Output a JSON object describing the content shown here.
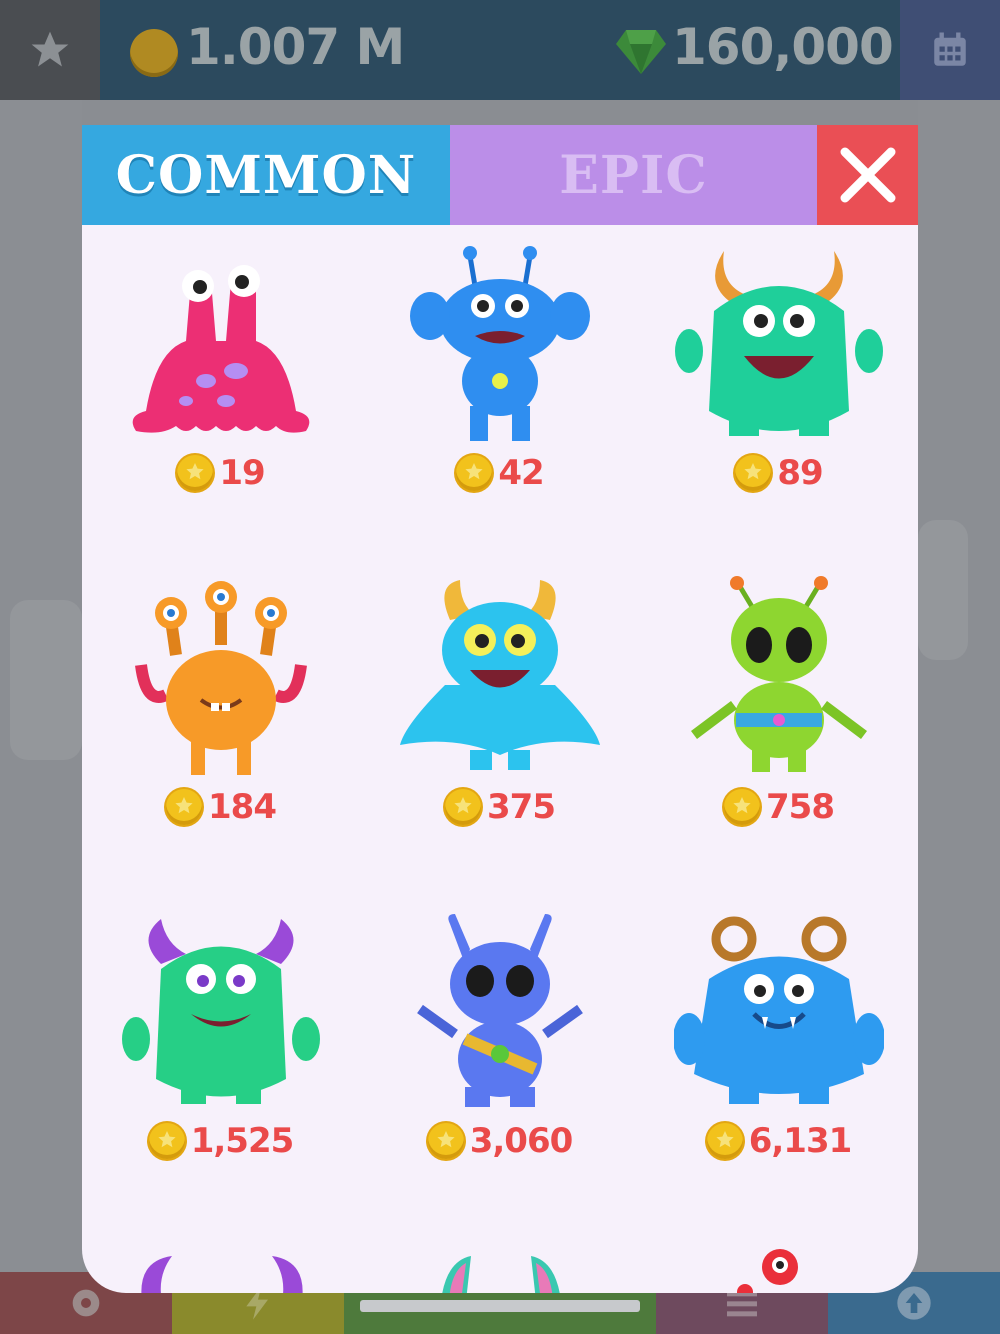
{
  "top_bar": {
    "coins": "1.007 M",
    "gems": "160,000",
    "icons": [
      "star-icon",
      "coin-icon",
      "gem-icon",
      "calendar-icon"
    ]
  },
  "tabs": {
    "common": "COMMON",
    "epic": "EPIC",
    "active": "common"
  },
  "monsters": [
    {
      "price": "19",
      "color": "#ec2f74"
    },
    {
      "price": "42",
      "color": "#2f8ef0"
    },
    {
      "price": "89",
      "color": "#1fcf9a"
    },
    {
      "price": "184",
      "color": "#f79a28"
    },
    {
      "price": "375",
      "color": "#2cc3ee"
    },
    {
      "price": "758",
      "color": "#8ed630"
    },
    {
      "price": "1,525",
      "color": "#26cf86"
    },
    {
      "price": "3,060",
      "color": "#5a78f0"
    },
    {
      "price": "6,131",
      "color": "#2e9bf0"
    }
  ],
  "bottom_bar": {
    "icons": [
      "gear-icon",
      "lightning-icon",
      "progress-bar",
      "menu-icon",
      "upgrade-arrow-icon"
    ]
  },
  "colors": {
    "price_text": "#ea4a4a",
    "tab_common": "#35a8e0",
    "tab_epic": "#bb8ee8",
    "close": "#ea4f55"
  }
}
